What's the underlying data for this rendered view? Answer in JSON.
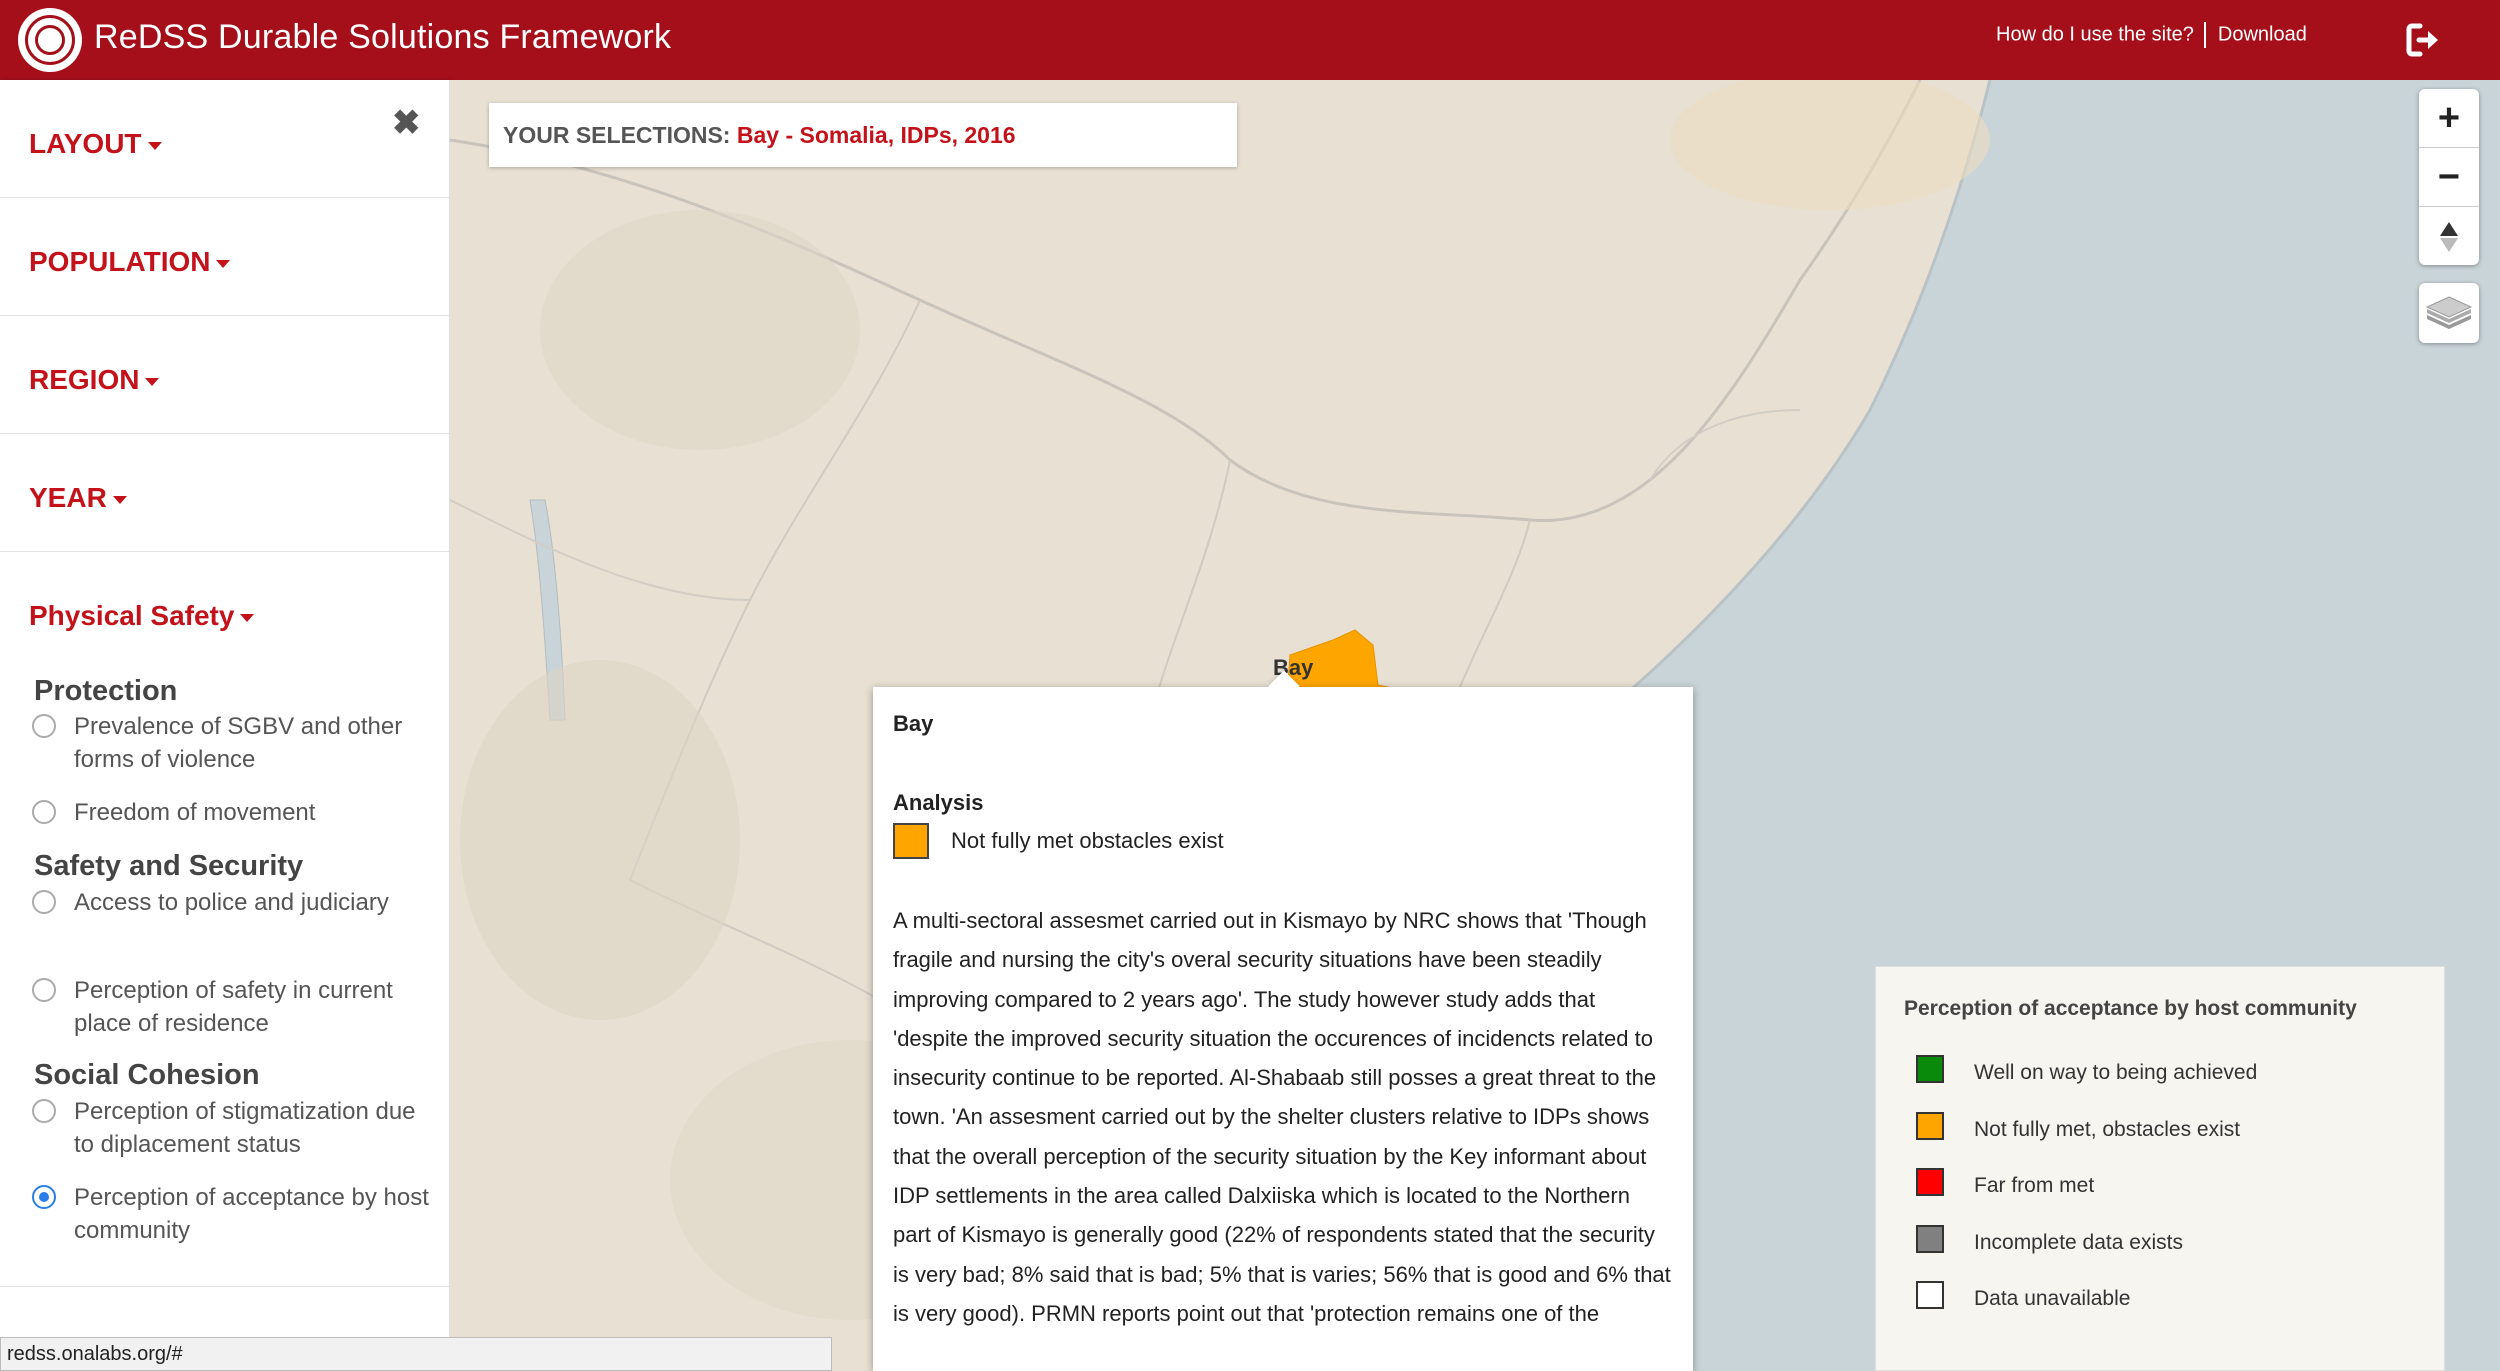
{
  "header": {
    "title": "ReDSS Durable Solutions Framework",
    "help_link": "How do I use the site?",
    "download_link": "Download",
    "logo_icon": "redss-logo-icon",
    "logout_icon": "logout-icon",
    "brand_color": "#a50f1a"
  },
  "sidebar": {
    "close_icon": "✖",
    "sections": [
      {
        "label": "LAYOUT"
      },
      {
        "label": "POPULATION"
      },
      {
        "label": "REGION"
      },
      {
        "label": "YEAR"
      }
    ],
    "indicator_section": {
      "label": "Physical Safety",
      "groups": [
        {
          "title": "Protection",
          "options": [
            {
              "label": "Prevalence of SGBV and other forms of violence",
              "selected": false
            },
            {
              "label": "Freedom of movement",
              "selected": false
            }
          ]
        },
        {
          "title": "Safety and Security",
          "options": [
            {
              "label": "Access to police and judiciary",
              "selected": false
            },
            {
              "label": "Perception of safety in current place of residence",
              "selected": false
            }
          ]
        },
        {
          "title": "Social Cohesion",
          "options": [
            {
              "label": "Perception of stigmatization due to diplacement status",
              "selected": false
            },
            {
              "label": "Perception of acceptance by host community",
              "selected": true
            }
          ]
        }
      ]
    }
  },
  "selections": {
    "label": "YOUR SELECTIONS:",
    "value": "Bay - Somalia, IDPs, 2016"
  },
  "map": {
    "region_label": "Bay",
    "highlight_color": "#ffa500",
    "zoom_in": "+",
    "zoom_out": "−",
    "reset_north": "▲",
    "layers_icon": "layers-icon"
  },
  "popup": {
    "region": "Bay",
    "analysis_heading": "Analysis",
    "status": "Not fully met obstacles exist",
    "status_color": "#ffa500",
    "body": "A multi-sectoral assesmet carried out in Kismayo by NRC shows that 'Though fragile and nursing the city's overal security situations have been steadily improving compared to 2 years ago'. The study however study adds that 'despite the improved security situation the occurences of incidencts related to insecurity continue to be reported. Al-Shabaab still posses a great threat to the town. 'An assesment carried out by the shelter clusters relative to IDPs shows that the overall perception of the security situation by the Key informant about IDP settlements in the area called Dalxiiska which is located to the Northern part of Kismayo is generally good (22% of respondents stated that the security is very bad; 8% said that is bad; 5% that is varies; 56% that is good and 6% that is very good). PRMN reports point out that 'protection remains one of the"
  },
  "legend": {
    "title": "Perception of acceptance by host community",
    "items": [
      {
        "label": "Well on way to being achieved",
        "color": "#0a8a0a"
      },
      {
        "label": "Not fully met, obstacles exist",
        "color": "#ffa500"
      },
      {
        "label": "Far from met",
        "color": "#ff0000"
      },
      {
        "label": "Incomplete data exists",
        "color": "#808080"
      },
      {
        "label": "Data unavailable",
        "color": "#ffffff"
      }
    ]
  },
  "status_bar": {
    "url": "redss.onalabs.org/#"
  }
}
